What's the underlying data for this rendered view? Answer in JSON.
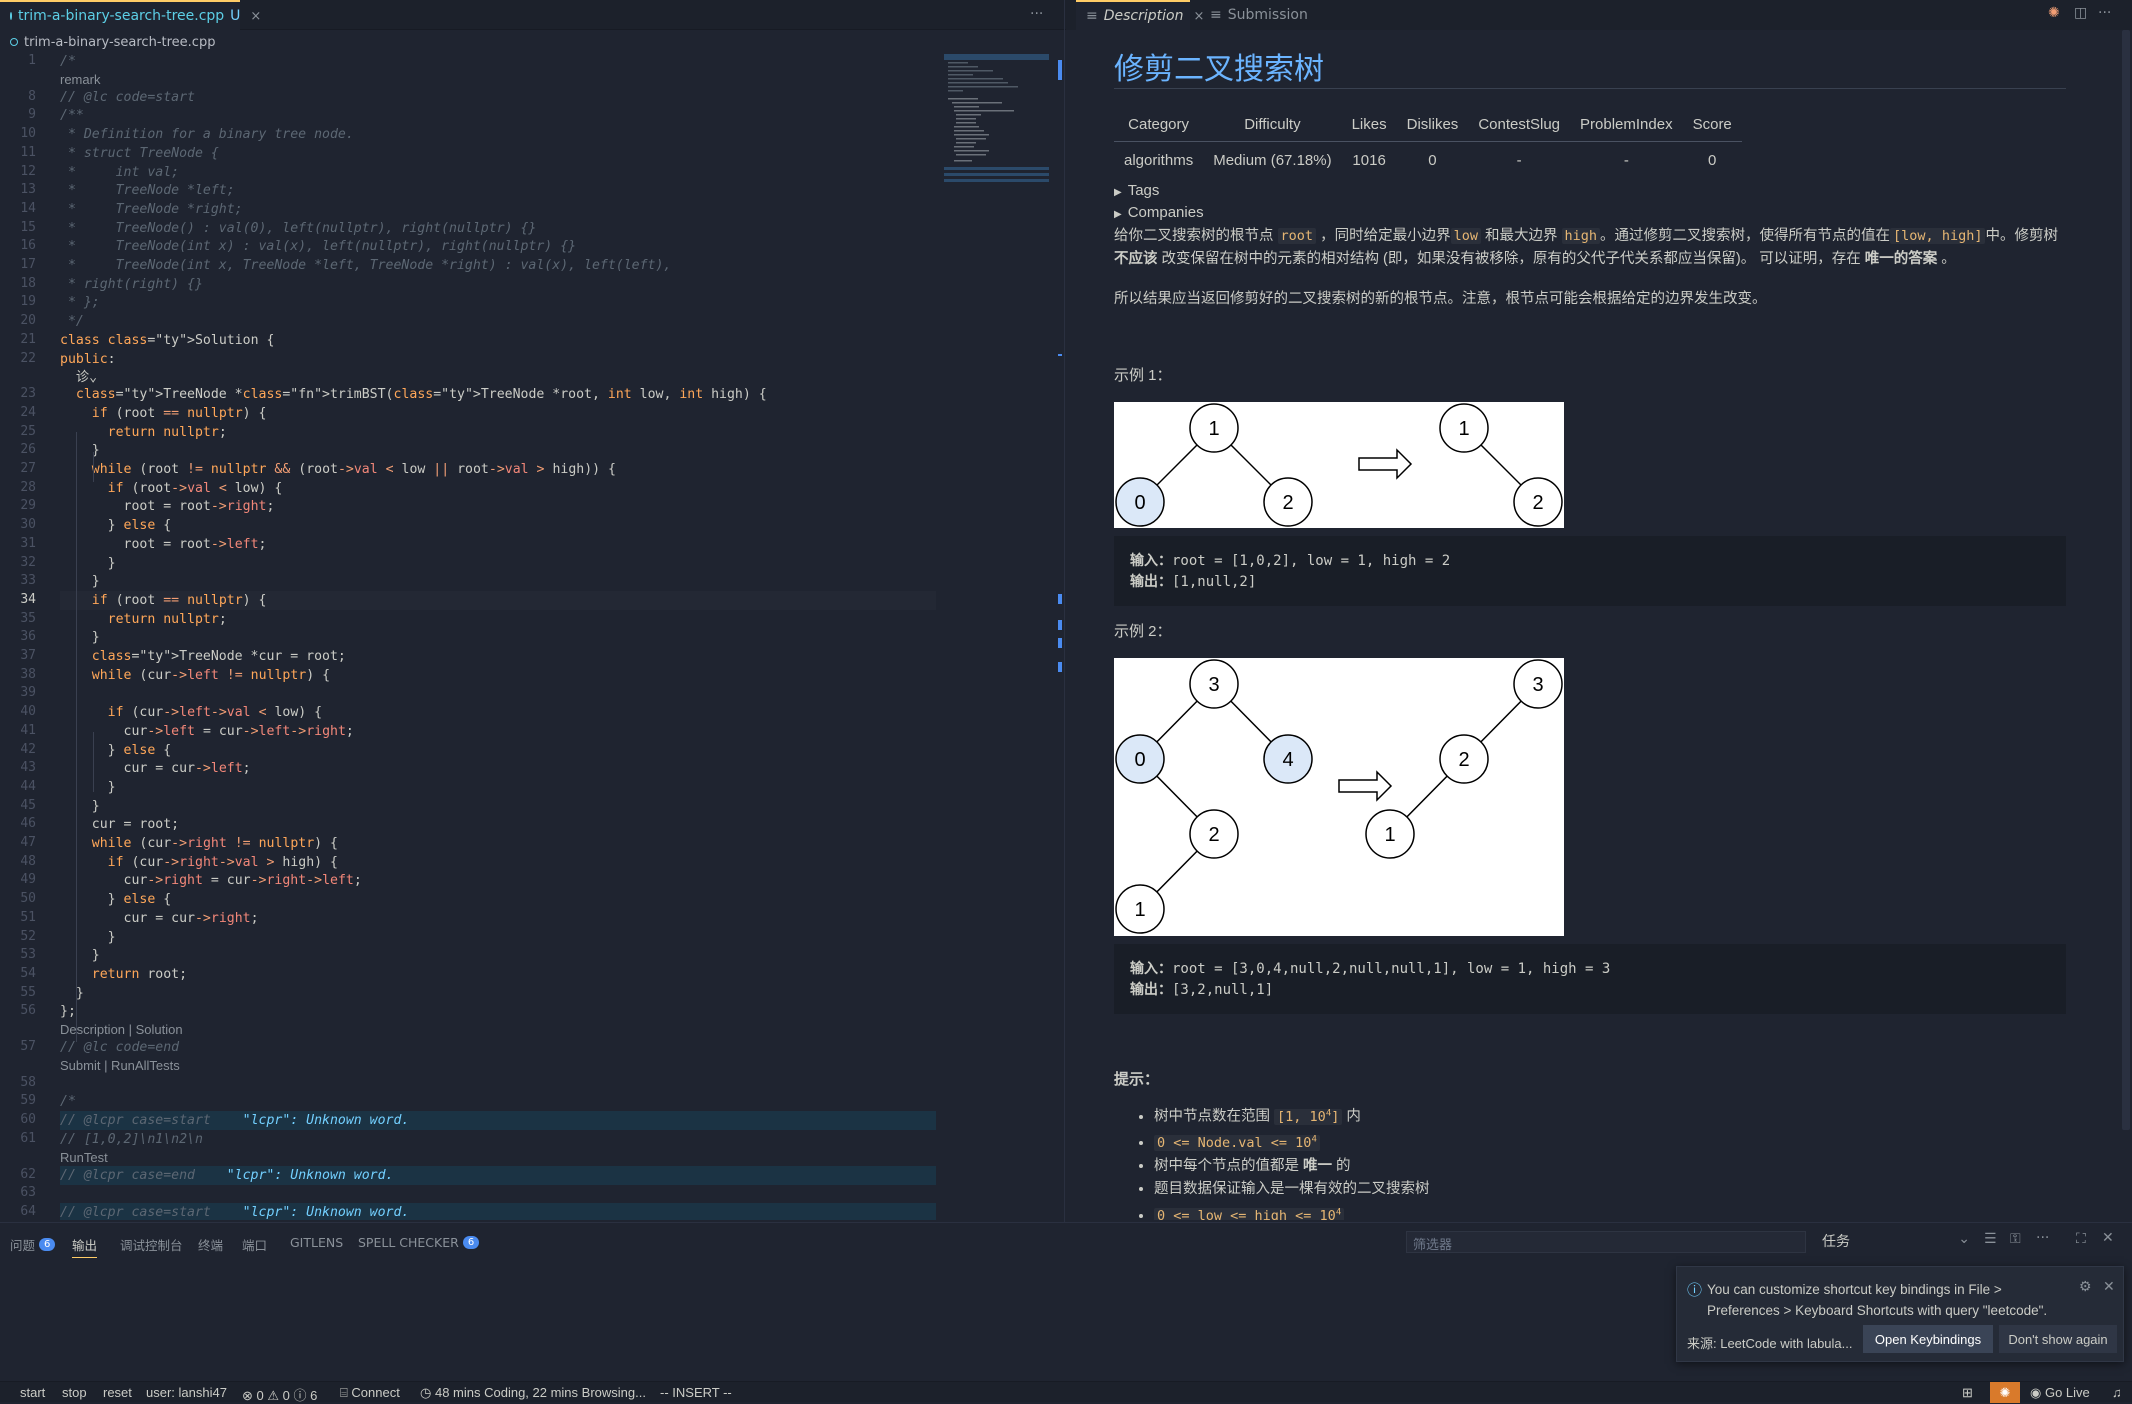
{
  "editor": {
    "tab": {
      "filename": "trim-a-binary-search-tree.cpp",
      "status": "U",
      "close": "×"
    },
    "tab_actions": "···",
    "breadcrumb": "trim-a-binary-search-tree.cpp",
    "current_line": "34",
    "lines": [
      {
        "n": "1",
        "text": "/*"
      },
      {
        "n": "",
        "text": "remark"
      },
      {
        "n": "8",
        "text": "// @lc code=start"
      },
      {
        "n": "9",
        "text": "/**"
      },
      {
        "n": "10",
        "text": " * Definition for a binary tree node."
      },
      {
        "n": "11",
        "text": " * struct TreeNode {"
      },
      {
        "n": "12",
        "text": " *     int val;"
      },
      {
        "n": "13",
        "text": " *     TreeNode *left;"
      },
      {
        "n": "14",
        "text": " *     TreeNode *right;"
      },
      {
        "n": "15",
        "text": " *     TreeNode() : val(0), left(nullptr), right(nullptr) {}"
      },
      {
        "n": "16",
        "text": " *     TreeNode(int x) : val(x), left(nullptr), right(nullptr) {}"
      },
      {
        "n": "17",
        "text": " *     TreeNode(int x, TreeNode *left, TreeNode *right) : val(x), left(left),"
      },
      {
        "n": "18",
        "text": " * right(right) {}"
      },
      {
        "n": "19",
        "text": " * };"
      },
      {
        "n": "20",
        "text": " */"
      },
      {
        "n": "21",
        "text": "class Solution {"
      },
      {
        "n": "22",
        "text": "public:"
      },
      {
        "n": "",
        "text": "  诊⌄"
      },
      {
        "n": "23",
        "text": "  TreeNode *trimBST(TreeNode *root, int low, int high) {"
      },
      {
        "n": "24",
        "text": "    if (root == nullptr) {"
      },
      {
        "n": "25",
        "text": "      return nullptr;"
      },
      {
        "n": "26",
        "text": "    }"
      },
      {
        "n": "27",
        "text": "    while (root != nullptr && (root->val < low || root->val > high)) {"
      },
      {
        "n": "28",
        "text": "      if (root->val < low) {"
      },
      {
        "n": "29",
        "text": "        root = root->right;"
      },
      {
        "n": "30",
        "text": "      } else {"
      },
      {
        "n": "31",
        "text": "        root = root->left;"
      },
      {
        "n": "32",
        "text": "      }"
      },
      {
        "n": "33",
        "text": "    }"
      },
      {
        "n": "34",
        "text": "    if (root == nullptr) {"
      },
      {
        "n": "35",
        "text": "      return nullptr;"
      },
      {
        "n": "36",
        "text": "    }"
      },
      {
        "n": "37",
        "text": "    TreeNode *cur = root;"
      },
      {
        "n": "38",
        "text": "    while (cur->left != nullptr) {"
      },
      {
        "n": "39",
        "text": ""
      },
      {
        "n": "40",
        "text": "      if (cur->left->val < low) {"
      },
      {
        "n": "41",
        "text": "        cur->left = cur->left->right;"
      },
      {
        "n": "42",
        "text": "      } else {"
      },
      {
        "n": "43",
        "text": "        cur = cur->left;"
      },
      {
        "n": "44",
        "text": "      }"
      },
      {
        "n": "45",
        "text": "    }"
      },
      {
        "n": "46",
        "text": "    cur = root;"
      },
      {
        "n": "47",
        "text": "    while (cur->right != nullptr) {"
      },
      {
        "n": "48",
        "text": "      if (cur->right->val > high) {"
      },
      {
        "n": "49",
        "text": "        cur->right = cur->right->left;"
      },
      {
        "n": "50",
        "text": "      } else {"
      },
      {
        "n": "51",
        "text": "        cur = cur->right;"
      },
      {
        "n": "52",
        "text": "      }"
      },
      {
        "n": "53",
        "text": "    }"
      },
      {
        "n": "54",
        "text": "    return root;"
      },
      {
        "n": "55",
        "text": "  }"
      },
      {
        "n": "56",
        "text": "};"
      },
      {
        "n": "",
        "text": "Description | Solution"
      },
      {
        "n": "57",
        "text": "// @lc code=end"
      },
      {
        "n": "",
        "text": "Submit | RunAllTests"
      },
      {
        "n": "58",
        "text": ""
      },
      {
        "n": "59",
        "text": "/*"
      },
      {
        "n": "60",
        "text": "// @lcpr case=start    \"lcpr\": Unknown word."
      },
      {
        "n": "61",
        "text": "// [1,0,2]\\n1\\n2\\n"
      },
      {
        "n": "",
        "text": "RunTest"
      },
      {
        "n": "62",
        "text": "// @lcpr case=end    \"lcpr\": Unknown word."
      },
      {
        "n": "63",
        "text": ""
      },
      {
        "n": "64",
        "text": "// @lcpr case=start    \"lcpr\": Unknown word."
      }
    ]
  },
  "right_tabs": {
    "description": "Description",
    "submission": "Submission",
    "close": "×"
  },
  "problem": {
    "title": "修剪二叉搜索树",
    "table": {
      "headers": [
        "Category",
        "Difficulty",
        "Likes",
        "Dislikes",
        "ContestSlug",
        "ProblemIndex",
        "Score"
      ],
      "row": [
        "algorithms",
        "Medium (67.18%)",
        "1016",
        "0",
        "-",
        "-",
        "0"
      ]
    },
    "tags": "Tags",
    "companies": "Companies",
    "desc1_parts": [
      "给你二叉搜索树的根节点 ",
      "root",
      " ，同时给定最小边界",
      "low",
      " 和最大边界 ",
      "high",
      "。通过修剪二叉搜索树，使得所有节点的值在",
      "[low, high]",
      "中。修剪树 ",
      "不应该",
      " 改变保留在树中的元素的相对结构 (即，如果没有被移除，原有的父代子代关系都应当保留)。 可以证明，存在 ",
      "唯一的答案",
      " 。"
    ],
    "desc2": "所以结果应当返回修剪好的二叉搜索树的新的根节点。注意，根节点可能会根据给定的边界发生改变。",
    "example1": {
      "label": "示例 1：",
      "input_label": "输入：",
      "input": "root = [1,0,2], low = 1, high = 2",
      "output_label": "输出：",
      "output": "[1,null,2]"
    },
    "example2": {
      "label": "示例 2：",
      "input_label": "输入：",
      "input": "root = [3,0,4,null,2,null,null,1], low = 1, high = 3",
      "output_label": "输出：",
      "output": "[3,2,null,1]"
    },
    "hints_label": "提示：",
    "hints": [
      {
        "pre": "树中节点数在范围 ",
        "code": "[1, 10",
        "sup": "4",
        "code_end": "]",
        "post": " 内"
      },
      {
        "pre": "",
        "code": "0 <= Node.val <= 10",
        "sup": "4",
        "code_end": "",
        "post": ""
      },
      {
        "pre": "树中每个节点的值都是 ",
        "code": "",
        "sup": "",
        "code_end": "",
        "post": "",
        "bold": "唯一",
        "post2": " 的"
      },
      {
        "pre": "题目数据保证输入是一棵有效的二叉搜索树",
        "code": "",
        "sup": "",
        "code_end": "",
        "post": ""
      },
      {
        "pre": "",
        "code": "0 <= low <= high <= 10",
        "sup": "4",
        "code_end": "",
        "post": ""
      }
    ],
    "tree_nodes": {
      "ex1_left": [
        "1",
        "0",
        "2"
      ],
      "ex1_right": [
        "1",
        "2"
      ],
      "ex2_left": [
        "3",
        "0",
        "4",
        "2",
        "1"
      ],
      "ex2_right": [
        "3",
        "2",
        "1"
      ]
    }
  },
  "panel": {
    "tabs": [
      {
        "label": "问题",
        "badge": "6"
      },
      {
        "label": "输出"
      },
      {
        "label": "调试控制台"
      },
      {
        "label": "终端"
      },
      {
        "label": "端口"
      },
      {
        "label": "GITLENS"
      },
      {
        "label": "SPELL CHECKER",
        "badge": "6"
      }
    ],
    "filter_placeholder": "筛选器",
    "task_select": "任务"
  },
  "toast": {
    "message": "You can customize shortcut key bindings in File > Preferences > Keyboard Shortcuts with query \"leetcode\".",
    "source": "来源: LeetCode with labula...",
    "primary": "Open Keybindings",
    "secondary": "Don't show again"
  },
  "statusbar": {
    "items": [
      "start",
      "stop",
      "reset",
      "user: lanshi47"
    ],
    "problems": "⊗ 0 ⚠ 0 ⓘ 6",
    "connect": "Connect",
    "timer": "48 mins Coding, 22 mins Browsing...",
    "mode": "-- INSERT --",
    "golive": "Go Live"
  },
  "colors": {
    "accent": "#ffcc66",
    "title_blue": "#6bb4ff",
    "link_cyan": "#5ccfe6",
    "badge_blue": "#4a8bf0",
    "node_highlight": "#dbe8f8"
  }
}
